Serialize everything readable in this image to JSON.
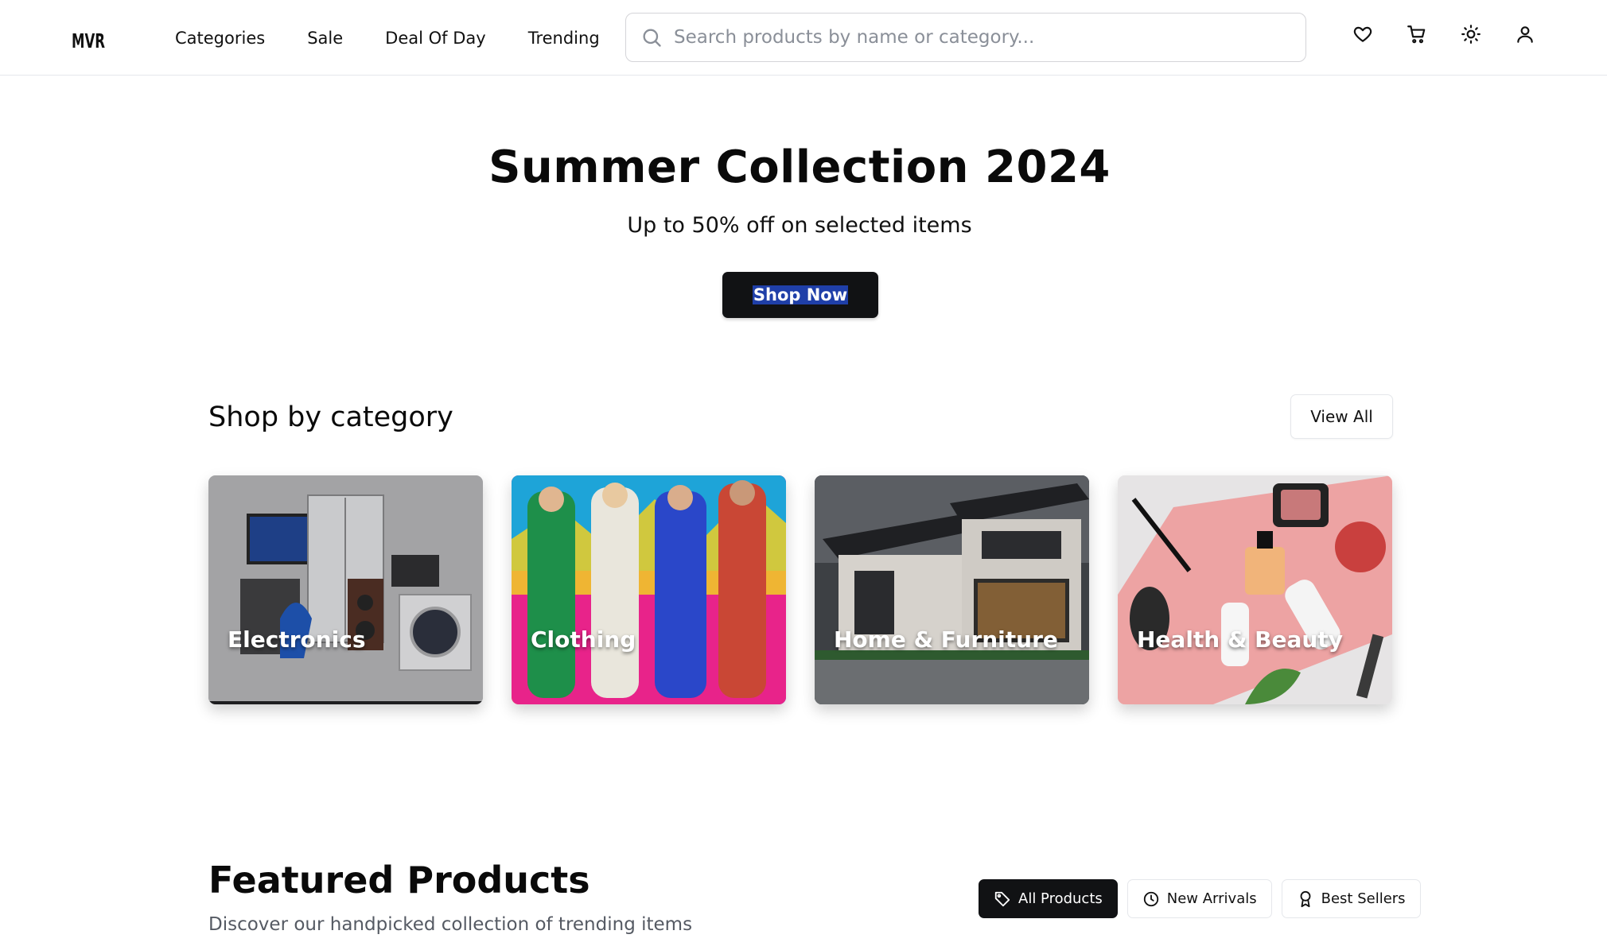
{
  "header": {
    "logo_text": "MVR",
    "nav": [
      "Categories",
      "Sale",
      "Deal Of Day",
      "Trending"
    ],
    "search": {
      "placeholder": "Search products by name or category...",
      "value": ""
    }
  },
  "hero": {
    "title": "Summer Collection 2024",
    "subtitle": "Up to 50% off on selected items",
    "cta": "Shop Now"
  },
  "categories": {
    "title": "Shop by category",
    "view_all": "View All",
    "items": [
      {
        "label": "Electronics"
      },
      {
        "label": "Clothing"
      },
      {
        "label": "Home & Furniture"
      },
      {
        "label": "Health & Beauty"
      }
    ]
  },
  "featured": {
    "title": "Featured Products",
    "subtitle": "Discover our handpicked collection of trending items",
    "filters": [
      {
        "label": "All Products",
        "icon": "tag-icon",
        "active": true
      },
      {
        "label": "New Arrivals",
        "icon": "clock-icon",
        "active": false
      },
      {
        "label": "Best Sellers",
        "icon": "award-icon",
        "active": false
      }
    ]
  },
  "colors": {
    "primary": "#111214",
    "highlight": "#1f3fa8",
    "border": "#e5e7eb",
    "muted": "#555a63"
  }
}
